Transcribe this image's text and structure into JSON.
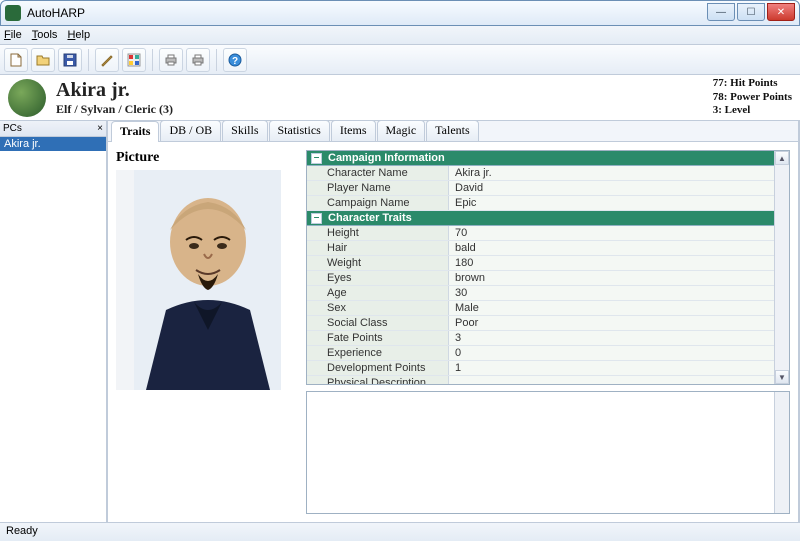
{
  "window": {
    "title": "AutoHARP"
  },
  "menu": {
    "file": "File",
    "tools": "Tools",
    "help": "Help"
  },
  "header": {
    "name": "Akira jr.",
    "subtitle": "Elf / Sylvan / Cleric (3)",
    "hp_line": "77: Hit Points",
    "pp_line": "78: Power Points",
    "lvl_line": "3: Level"
  },
  "sidepanel": {
    "title": "PCs",
    "items": [
      "Akira jr."
    ]
  },
  "tabs": [
    "Traits",
    "DB / OB",
    "Skills",
    "Statistics",
    "Items",
    "Magic",
    "Talents"
  ],
  "active_tab": "Traits",
  "picture_label": "Picture",
  "sections": {
    "campaign": {
      "title": "Campaign Information",
      "rows": [
        {
          "label": "Character Name",
          "value": "Akira jr."
        },
        {
          "label": "Player Name",
          "value": "David"
        },
        {
          "label": "Campaign Name",
          "value": "Epic"
        }
      ]
    },
    "traits": {
      "title": "Character Traits",
      "rows": [
        {
          "label": "Height",
          "value": "70"
        },
        {
          "label": "Hair",
          "value": "bald"
        },
        {
          "label": "Weight",
          "value": "180"
        },
        {
          "label": "Eyes",
          "value": "brown"
        },
        {
          "label": "Age",
          "value": "30"
        },
        {
          "label": "Sex",
          "value": "Male"
        },
        {
          "label": "Social Class",
          "value": "Poor"
        },
        {
          "label": "Fate Points",
          "value": "3"
        },
        {
          "label": "Experience",
          "value": "0"
        },
        {
          "label": "Development Points",
          "value": "1"
        },
        {
          "label": "Physical Description",
          "value": ""
        }
      ]
    }
  },
  "status": "Ready"
}
